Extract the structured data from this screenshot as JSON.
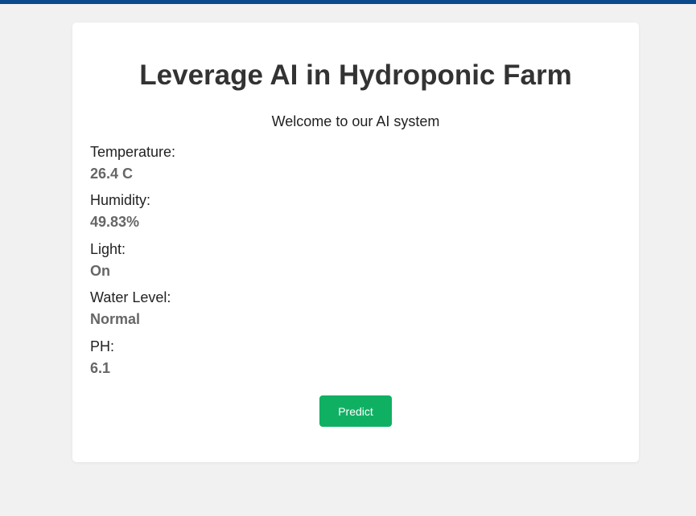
{
  "header": {
    "title": "Leverage AI in Hydroponic Farm",
    "subtitle": "Welcome to our AI system"
  },
  "readings": [
    {
      "label": "Temperature:",
      "value": "26.4 C"
    },
    {
      "label": "Humidity:",
      "value": "49.83%"
    },
    {
      "label": "Light:",
      "value": "On"
    },
    {
      "label": "Water Level:",
      "value": "Normal"
    },
    {
      "label": "PH:",
      "value": "6.1"
    }
  ],
  "actions": {
    "predict_label": "Predict"
  },
  "colors": {
    "top_bar": "#0a4a8c",
    "background": "#f1f1f1",
    "card": "#ffffff",
    "button": "#10b063",
    "value_text": "#666666"
  }
}
